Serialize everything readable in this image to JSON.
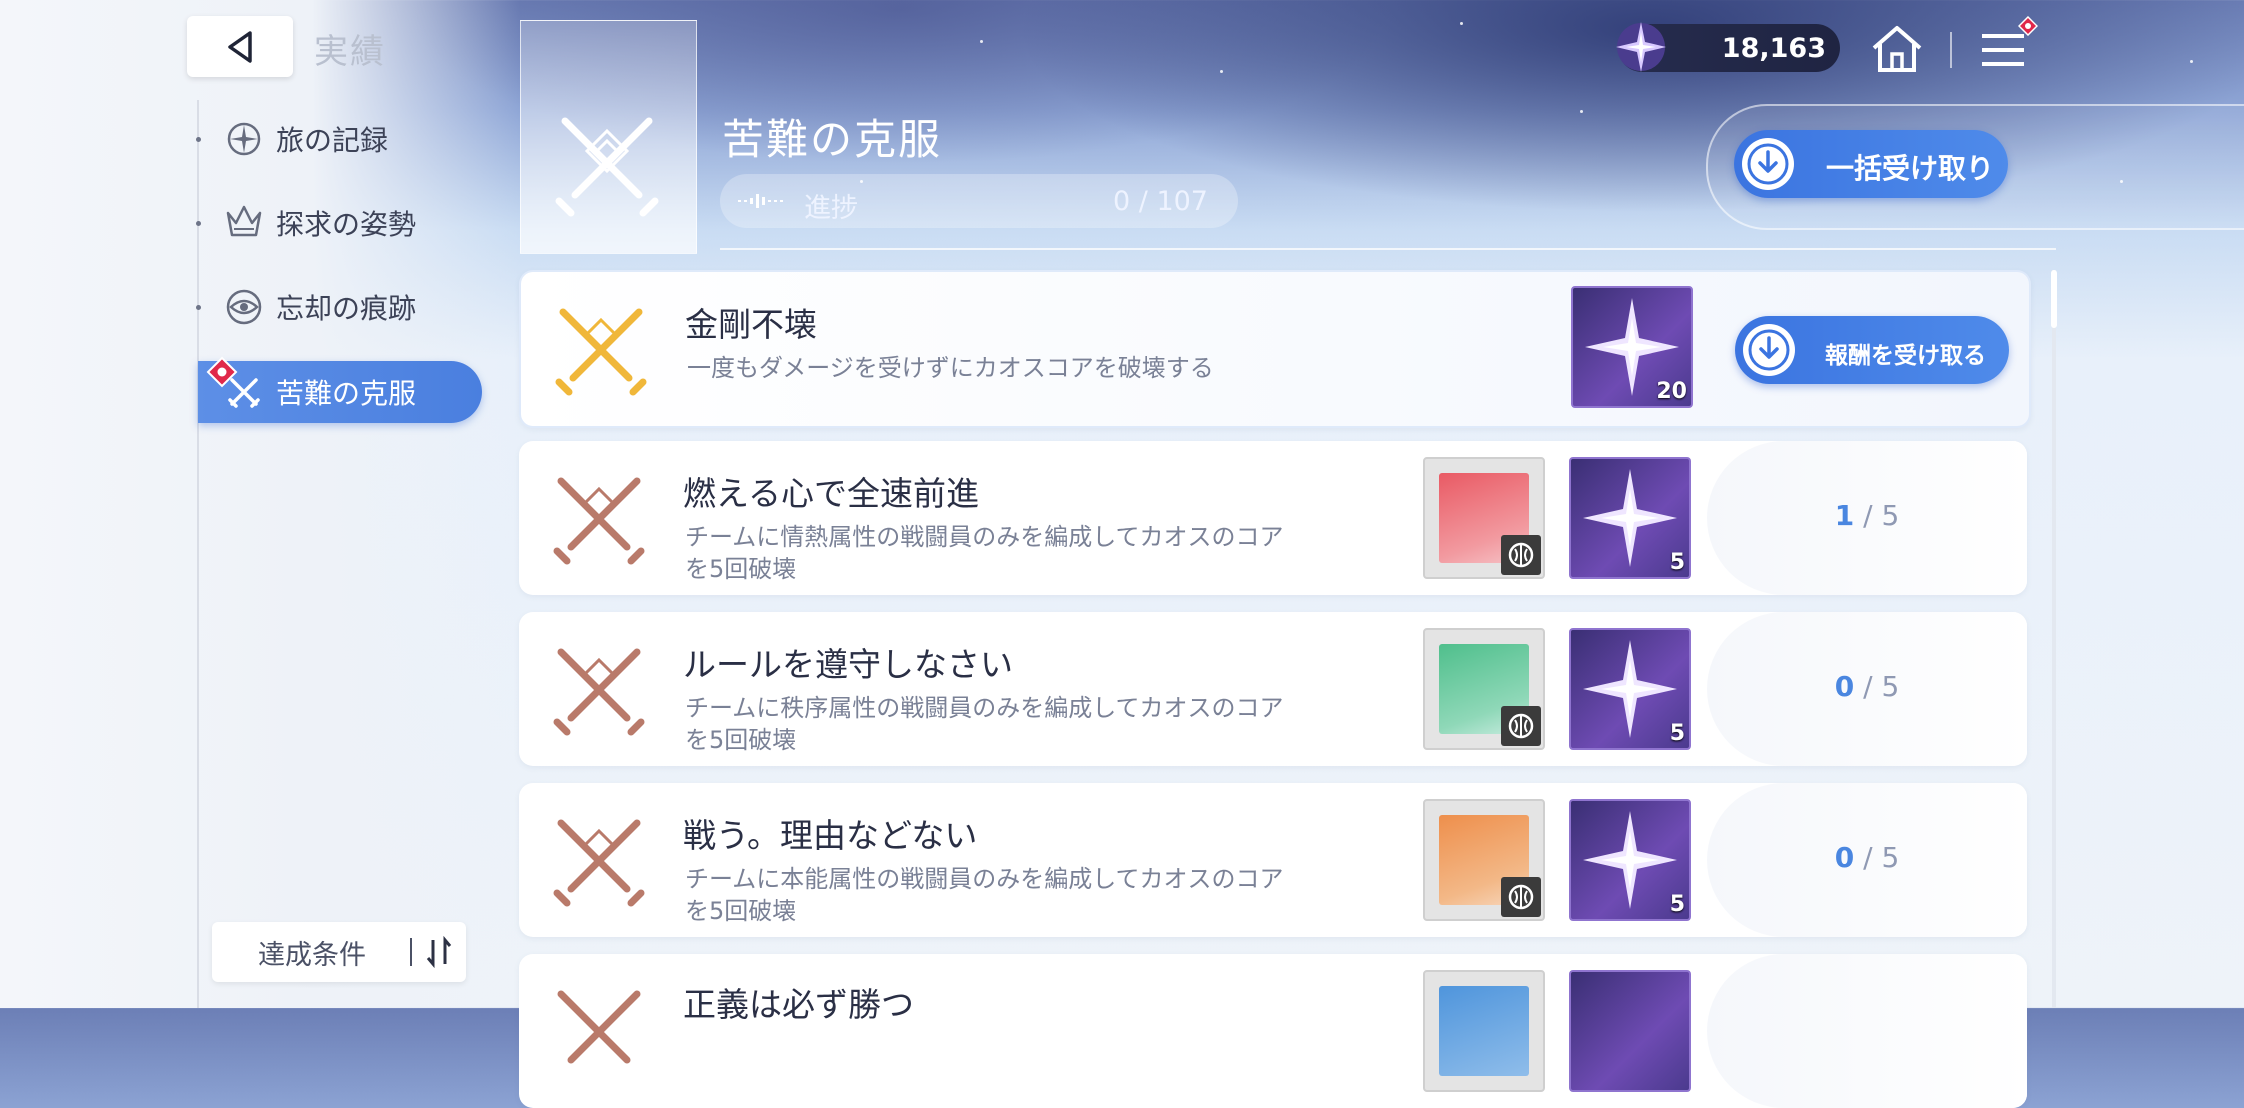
{
  "header": {
    "title": "実績",
    "currency_value": "18,163"
  },
  "sidebar": {
    "items": [
      {
        "label": "旅の記録",
        "icon": "compass-icon"
      },
      {
        "label": "探求の姿勢",
        "icon": "crown-icon"
      },
      {
        "label": "忘却の痕跡",
        "icon": "eye-icon"
      },
      {
        "label": "苦難の克服",
        "icon": "crossed-swords-icon"
      }
    ],
    "sort_label": "達成条件"
  },
  "category": {
    "title": "苦難の克服",
    "progress_label": "進捗",
    "progress_value": "0 / 107",
    "claim_all_label": "一括受け取り"
  },
  "achievements": [
    {
      "title": "金剛不壊",
      "desc": "一度もダメージを受けずにカオスコアを破壊する",
      "gem_qty": "20",
      "claim_label": "報酬を受け取る",
      "status": "claimable"
    },
    {
      "title": "燃える心で全速前進",
      "desc": "チームに情熱属性の戦闘員のみを編成してカオスのコアを5回破壊",
      "gem_qty": "5",
      "progress_current": "1",
      "progress_total": "/ 5",
      "card_color": "#ea6f75"
    },
    {
      "title": "ルールを遵守しなさい",
      "desc": "チームに秩序属性の戦闘員のみを編成してカオスのコアを5回破壊",
      "gem_qty": "5",
      "progress_current": "0",
      "progress_total": "/ 5",
      "card_color": "#5fbf96"
    },
    {
      "title": "戦う。理由などない",
      "desc": "チームに本能属性の戦闘員のみを編成してカオスのコアを5回破壊",
      "gem_qty": "5",
      "progress_current": "0",
      "progress_total": "/ 5",
      "card_color": "#f09a58"
    },
    {
      "title": "正義は必ず勝つ",
      "desc": "",
      "gem_qty": "",
      "card_color": "#5a9be0"
    }
  ]
}
